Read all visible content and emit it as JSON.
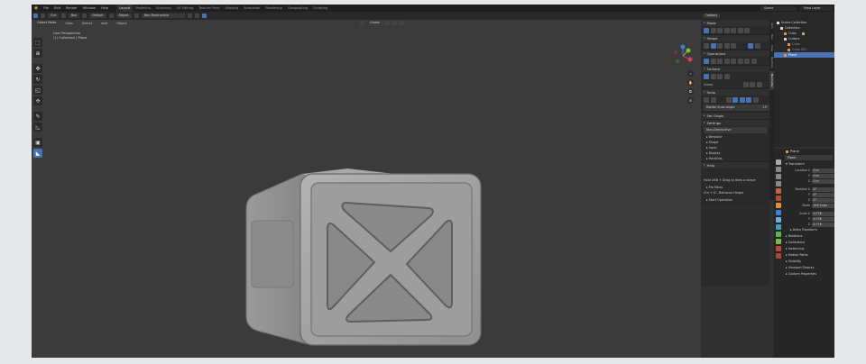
{
  "topbar": {
    "menus": [
      "File",
      "Edit",
      "Render",
      "Window",
      "Help"
    ],
    "workspaces": [
      "Layout",
      "Modeling",
      "Sculpting",
      "UV Editing",
      "Texture Paint",
      "Shading",
      "Animation",
      "Rendering",
      "Compositing",
      "Scripting"
    ],
    "active_workspace": "Layout",
    "scene": "Scene",
    "view_layer": "View Layer"
  },
  "tool_header": {
    "items": [
      "Cut",
      "Box",
      "Default",
      "Object",
      "Non-Destructive"
    ],
    "options": "Options"
  },
  "viewport_header": {
    "mode": "Object Mode",
    "menus": [
      "View",
      "Select",
      "Add",
      "Object"
    ],
    "orientation": "Global"
  },
  "viewport": {
    "perspective": "User Perspective",
    "collection": "(1) Collection | Plane"
  },
  "npanel": {
    "sections": {
      "mode": "Mode",
      "shape": "Shape",
      "operations": "Operations",
      "surface": "Surface",
      "gizmo": "Gizmo",
      "snap": "Snap",
      "rotate_snap": "Rotate Snap Angle",
      "rotate_snap_val": "15",
      "set_origin": "Set Origin",
      "settings": "Settings",
      "settings_mode": "Non-Destructive",
      "settings_subs": [
        "Behavior",
        "Shape",
        "Input",
        "Display",
        "HardOps"
      ],
      "help": "Help",
      "help_line1": "Hold LMB + Drag to draw a shape",
      "pie_menu": "Pie Menu",
      "help_line2": "Ctrl + D - Behavior Helper",
      "start_operation": "Start Operation"
    },
    "tabs": [
      "Item",
      "Tool",
      "View",
      "HardOps",
      "BoxCutter"
    ],
    "active_tab": "BoxCutter"
  },
  "outliner": {
    "rows": [
      {
        "label": "Scene Collection",
        "indent": 0,
        "icon": "white"
      },
      {
        "label": "Collection",
        "indent": 1,
        "icon": "white"
      },
      {
        "label": "Cube",
        "indent": 2,
        "icon": "orange"
      },
      {
        "label": "Cutters",
        "indent": 2,
        "icon": "white"
      },
      {
        "label": "Cube",
        "indent": 3,
        "icon": "orange"
      },
      {
        "label": "Cube.001",
        "indent": 3,
        "icon": "orange"
      },
      {
        "label": "Plane",
        "indent": 2,
        "icon": "orange",
        "selected": true
      }
    ]
  },
  "properties": {
    "object_name": "Plane",
    "name_field": "Plane",
    "transform": "Transform",
    "location_label": "Location X",
    "location": [
      "0 m",
      "0 m",
      "0 m"
    ],
    "rotation_label": "Rotation X",
    "rotation": [
      "0°",
      "0°",
      "0°"
    ],
    "mode_label": "Mode",
    "mode_value": "XYZ Euler",
    "scale_label": "Scale X",
    "scale": [
      "0.776",
      "0.776",
      "0.776"
    ],
    "y_label": "Y",
    "z_label": "Z",
    "delta": "Delta Transform",
    "panels": [
      "Relations",
      "Collections",
      "Instancing",
      "Motion Paths",
      "Visibility",
      "Viewport Display",
      "Custom Properties"
    ]
  },
  "colors": {
    "accent": "#4772b3",
    "gizmo_x": "#e0404f",
    "gizmo_y": "#7cc43a",
    "gizmo_z": "#3e7ad6"
  }
}
